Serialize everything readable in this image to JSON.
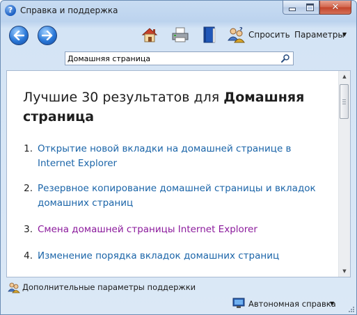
{
  "window": {
    "title": "Справка и поддержка"
  },
  "toolbar": {
    "ask_label": "Спросить",
    "params_label": "Параметры"
  },
  "search": {
    "value": "Домашняя страница"
  },
  "content": {
    "heading_prefix": "Лучшие 30 результатов для ",
    "heading_query": "Домашняя страница",
    "results": [
      {
        "num": "1.",
        "text": "Открытие новой вкладки на домашней странице в Internet Explorer",
        "visited": false
      },
      {
        "num": "2.",
        "text": "Резервное копирование домашней страницы и вкладок домашних страниц",
        "visited": false
      },
      {
        "num": "3.",
        "text": "Смена домашней страницы Internet Explorer",
        "visited": true
      },
      {
        "num": "4.",
        "text": "Изменение порядка вкладок домашних страниц",
        "visited": false
      }
    ]
  },
  "footer": {
    "support_label": "Дополнительные параметры поддержки",
    "offline_label": "Автономная справка"
  },
  "colors": {
    "link": "#1a64a8",
    "visited_link": "#8b1a9c"
  }
}
